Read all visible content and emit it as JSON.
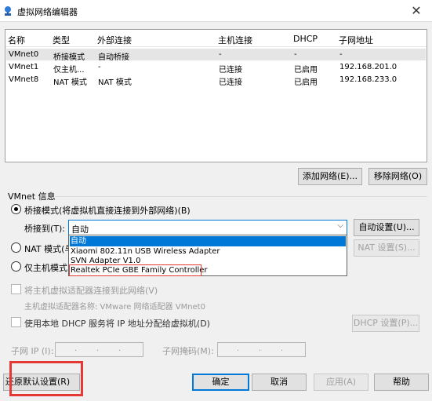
{
  "window": {
    "title": "虚拟网络编辑器",
    "close_glyph": "✕"
  },
  "network_table": {
    "columns": [
      "名称",
      "类型",
      "外部连接",
      "主机连接",
      "DHCP",
      "子网地址"
    ],
    "rows": [
      [
        "VMnet0",
        "桥接模式",
        "自动桥接",
        "-",
        "-",
        "-"
      ],
      [
        "VMnet1",
        "仅主机...",
        "-",
        "已连接",
        "已启用",
        "192.168.201.0"
      ],
      [
        "VMnet8",
        "NAT 模式",
        "NAT 模式",
        "已连接",
        "已启用",
        "192.168.233.0"
      ]
    ]
  },
  "table_buttons": {
    "add": "添加网络(E)...",
    "remove": "移除网络(O)"
  },
  "vmnet_info": {
    "section_label": "VMnet 信息",
    "bridged_label": "桥接模式(将虚拟机直接连接到外部网络)(B)",
    "bridged_selected": true,
    "bridge_to_label": "桥接到(T):",
    "bridge_to_value": "自动",
    "dropdown_options": [
      "自动",
      "Xiaomi 802.11n USB Wireless Adapter",
      "SVN Adapter V1.0",
      "Realtek PCIe GBE Family Controller"
    ],
    "auto_settings": "自动设置(U)...",
    "nat_label": "NAT 模式(与",
    "nat_settings": "NAT 设置(S)...",
    "host_only_label": "仅主机模式",
    "connect_host_adapter": "将主机虚拟适配器连接到此网络(V)",
    "host_adapter_name": "主机虚拟适配器名称: VMware 网络适配器 VMnet0",
    "use_dhcp": "使用本地 DHCP 服务将 IP 地址分配给虚拟机(D)",
    "dhcp_settings": "DHCP 设置(P)...",
    "subnet_ip_label": "子网 IP (I):",
    "subnet_mask_label": "子网掩码(M):",
    "ip_dots": ". . ."
  },
  "footer": {
    "restore_defaults": "原默认设置(R)",
    "restore_prefix": "还",
    "ok": "确定",
    "cancel": "取消",
    "apply": "应用(A)",
    "help": "帮助"
  },
  "colors": {
    "highlight": "#0078d7",
    "annotation_red": "#e53935"
  }
}
